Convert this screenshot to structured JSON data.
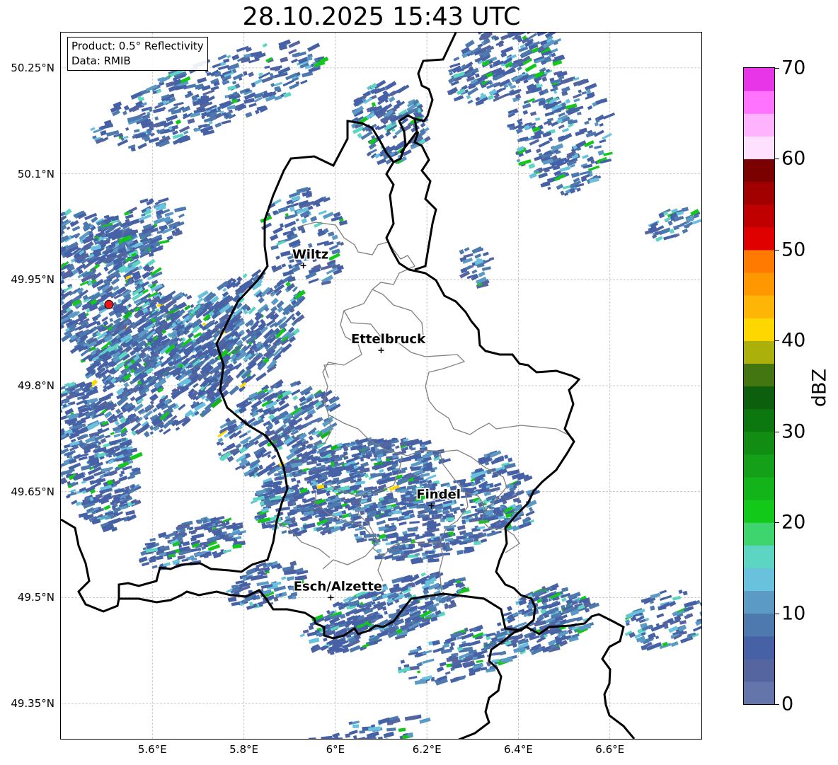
{
  "title": "28.10.2025 15:43 UTC",
  "info_box": {
    "product": "Product: 0.5° Reflectivity",
    "data": "Data: RMIB"
  },
  "map": {
    "lon_range": [
      5.4,
      6.8
    ],
    "lat_range": [
      49.3,
      50.3
    ],
    "lat_ticks": [
      {
        "value": 50.25,
        "label": "50.25°N"
      },
      {
        "value": 50.1,
        "label": "50.1°N"
      },
      {
        "value": 49.95,
        "label": "49.95°N"
      },
      {
        "value": 49.8,
        "label": "49.8°N"
      },
      {
        "value": 49.65,
        "label": "49.65°N"
      },
      {
        "value": 49.5,
        "label": "49.5°N"
      },
      {
        "value": 49.35,
        "label": "49.35°N"
      }
    ],
    "lon_ticks": [
      {
        "value": 5.6,
        "label": "5.6°E"
      },
      {
        "value": 5.8,
        "label": "5.8°E"
      },
      {
        "value": 6.0,
        "label": "6°E"
      },
      {
        "value": 6.2,
        "label": "6.2°E"
      },
      {
        "value": 6.4,
        "label": "6.4°E"
      },
      {
        "value": 6.6,
        "label": "6.6°E"
      }
    ],
    "grid": true,
    "cities": [
      {
        "name": "Wiltz",
        "lon": 5.93,
        "lat": 49.97
      },
      {
        "name": "Ettelbruck",
        "lon": 6.1,
        "lat": 49.85
      },
      {
        "name": "Findel",
        "lon": 6.21,
        "lat": 49.63
      },
      {
        "name": "Esch/Alzette",
        "lon": 5.99,
        "lat": 49.5
      }
    ],
    "radar_site": {
      "lon": 5.505,
      "lat": 49.915,
      "color": "#e41a1c"
    }
  },
  "colorbar": {
    "label": "dBZ",
    "min": 0,
    "max": 70,
    "ticks": [
      0,
      10,
      20,
      30,
      40,
      50,
      60,
      70
    ],
    "colors": [
      "#6375aa",
      "#55659f",
      "#4661a6",
      "#4d79ae",
      "#5a9ac5",
      "#68c1dd",
      "#5cd6c2",
      "#3ed46e",
      "#12c91a",
      "#13b41a",
      "#14a019",
      "#118d14",
      "#0c760f",
      "#0c5f0c",
      "#437510",
      "#acb00a",
      "#ffd700",
      "#ffb505",
      "#ff9800",
      "#ff7a00",
      "#e10000",
      "#c00000",
      "#a20000",
      "#7b0000",
      "#ffe1ff",
      "#ffb3ff",
      "#ff73ff",
      "#e835e8"
    ]
  },
  "chart_data": {
    "type": "heatmap",
    "title": "28.10.2025 15:43 UTC",
    "xlabel": "",
    "ylabel": "",
    "colorbar_label": "dBZ",
    "value_range": [
      0,
      70
    ],
    "xlim": [
      5.4,
      6.8
    ],
    "ylim": [
      49.3,
      50.3
    ]
  }
}
